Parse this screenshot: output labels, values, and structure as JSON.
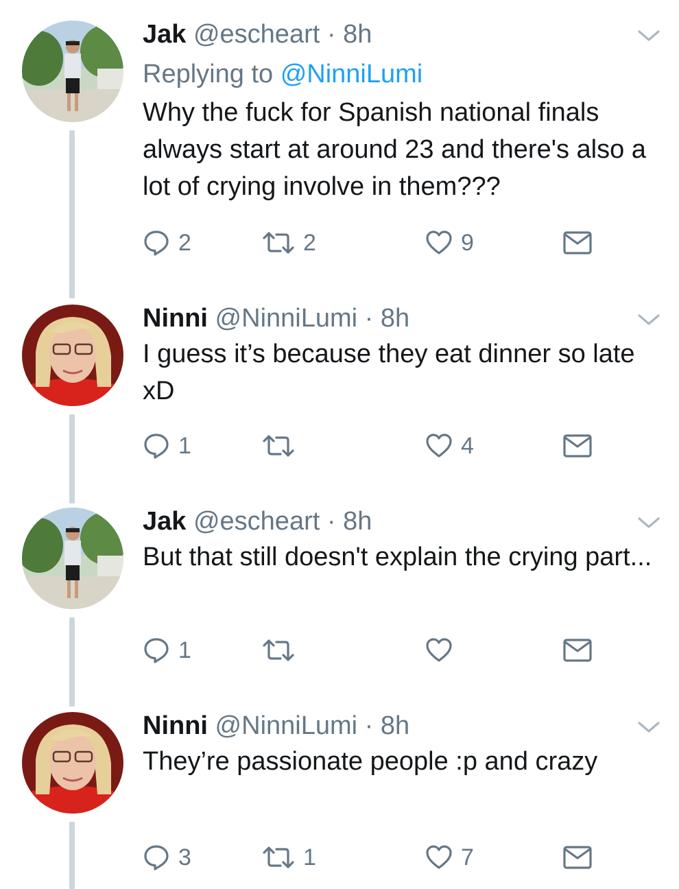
{
  "tweets": [
    {
      "name": "Jak",
      "handle": "@escheart",
      "time": "· 8h",
      "reply_prefix": "Replying to",
      "reply_handle": "@NinniLumi",
      "text": "Why the fuck for Spanish national finals always start at around 23 and there's also a lot of crying involve in them???",
      "replies": "2",
      "retweets": "2",
      "likes": "9",
      "avatar": "jak-avatar"
    },
    {
      "name": "Ninni",
      "handle": "@NinniLumi",
      "time": "· 8h",
      "text": "I guess it’s because they eat dinner so late xD",
      "replies": "1",
      "retweets": "",
      "likes": "4",
      "avatar": "ninni-avatar"
    },
    {
      "name": "Jak",
      "handle": "@escheart",
      "time": "· 8h",
      "text": "But that still doesn't explain the crying part...",
      "replies": "1",
      "retweets": "",
      "likes": "",
      "avatar": "jak-avatar"
    },
    {
      "name": "Ninni",
      "handle": "@NinniLumi",
      "time": "· 8h",
      "text": "They’re passionate people :p and crazy",
      "replies": "3",
      "retweets": "1",
      "likes": "7",
      "avatar": "ninni-avatar"
    }
  ],
  "colors": {
    "text": "#14171a",
    "secondary": "#657786",
    "link": "#1da1f2",
    "thread_line": "#ccd6dd"
  },
  "icons": [
    "reply-icon",
    "retweet-icon",
    "like-icon",
    "dm-icon",
    "chevron-down-icon"
  ]
}
